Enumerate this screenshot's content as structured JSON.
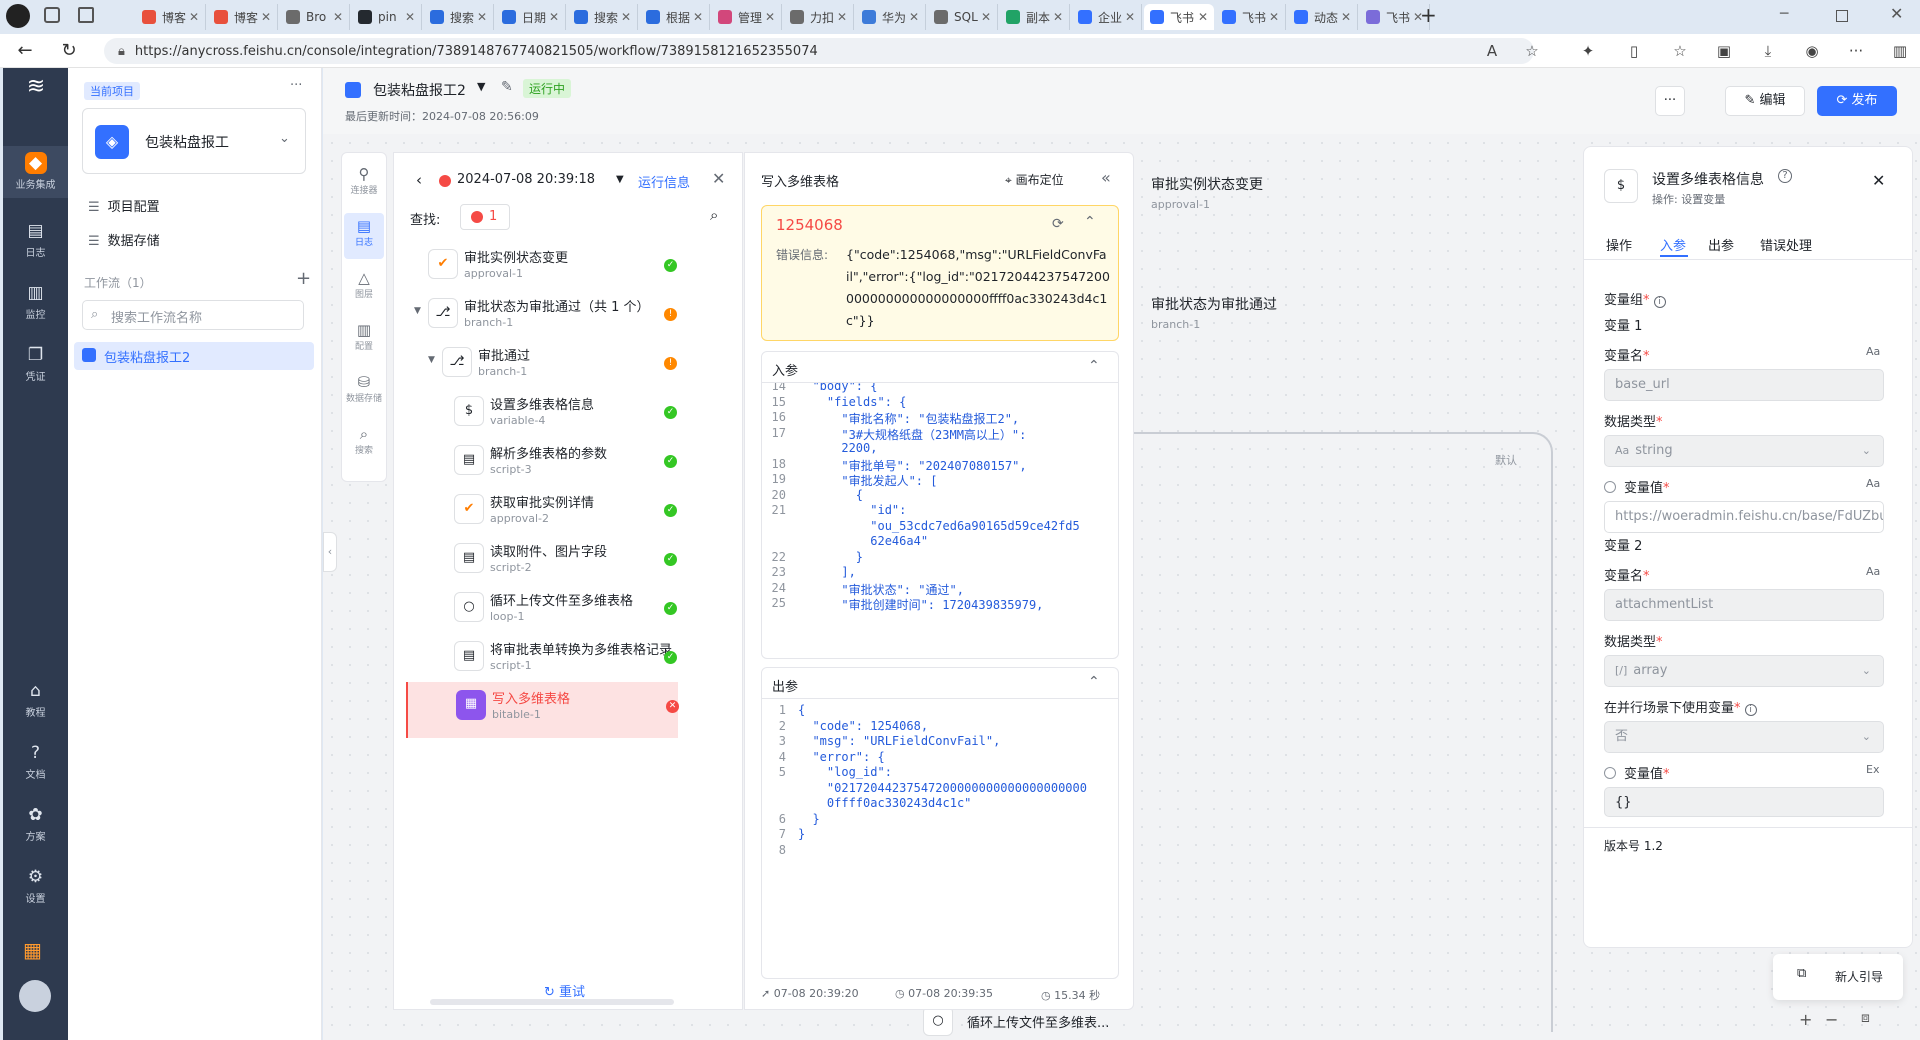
{
  "browser": {
    "tabs": [
      {
        "label": "博客",
        "color": "#e8503c"
      },
      {
        "label": "博客",
        "color": "#e8503c"
      },
      {
        "label": "Bro",
        "color": "#6b6b6b"
      },
      {
        "label": "pin",
        "color": "#24292f"
      },
      {
        "label": "搜索",
        "color": "#2b6cde"
      },
      {
        "label": "日期",
        "color": "#2b6cde"
      },
      {
        "label": "搜索",
        "color": "#2b6cde"
      },
      {
        "label": "根据",
        "color": "#2b6cde"
      },
      {
        "label": "管理",
        "color": "#d2477b"
      },
      {
        "label": "力扣",
        "color": "#6b6b6b"
      },
      {
        "label": "华为",
        "color": "#3d7bd9"
      },
      {
        "label": "SQL",
        "color": "#6b6b6b"
      },
      {
        "label": "副本",
        "color": "#21a366"
      },
      {
        "label": "企业",
        "color": "#3370ff"
      },
      {
        "label": "飞书",
        "color": "#3370ff"
      },
      {
        "label": "飞书",
        "color": "#3370ff"
      },
      {
        "label": "动态",
        "color": "#3370ff"
      },
      {
        "label": "飞书",
        "color": "#7b6cd9"
      }
    ],
    "url": "https://anycross.feishu.cn/console/integration/7389148767740821505/workflow/7389158121652355074"
  },
  "rail": {
    "items": [
      {
        "label": "业务集成"
      },
      {
        "label": "日志"
      },
      {
        "label": "监控"
      },
      {
        "label": "凭证"
      }
    ],
    "bottom": [
      {
        "label": "教程"
      },
      {
        "label": "文档"
      },
      {
        "label": "方案"
      },
      {
        "label": "设置"
      }
    ]
  },
  "project": {
    "current_label": "当前项目",
    "name": "包装粘盘报工",
    "menu": [
      "项目配置",
      "数据存储"
    ],
    "workflows_label": "工作流（1）",
    "search_placeholder": "搜索工作流名称",
    "workflow_item": "包装粘盘报工2"
  },
  "header": {
    "title": "包装粘盘报工2",
    "status": "运行中",
    "updated": "最后更新时间：2024-07-08 20:56:09",
    "more": "···",
    "edit_label": "编辑",
    "publish_label": "发布"
  },
  "tool_strip": [
    "连接器",
    "日志",
    "图层",
    "配置",
    "数据存储",
    "搜索"
  ],
  "run": {
    "timestamp": "2024-07-08 20:39:18",
    "info_label": "运行信息",
    "find_label": "查找:",
    "error_count": "1",
    "retry_label": "重试",
    "steps": [
      {
        "title": "审批实例状态变更",
        "sub": "approval-1",
        "status": "ok"
      },
      {
        "title": "审批状态为审批通过（共 1 个）",
        "sub": "branch-1",
        "status": "warn"
      },
      {
        "title": "审批通过",
        "sub": "branch-1",
        "status": "warn"
      },
      {
        "title": "设置多维表格信息",
        "sub": "variable-4",
        "status": "ok"
      },
      {
        "title": "解析多维表格的参数",
        "sub": "script-3",
        "status": "ok"
      },
      {
        "title": "获取审批实例详情",
        "sub": "approval-2",
        "status": "ok"
      },
      {
        "title": "读取附件、图片字段",
        "sub": "script-2",
        "status": "ok"
      },
      {
        "title": "循环上传文件至多维表格",
        "sub": "loop-1",
        "status": "ok"
      },
      {
        "title": "将审批表单转换为多维表格记录",
        "sub": "script-1",
        "status": "ok"
      },
      {
        "title": "写入多维表格",
        "sub": "bitable-1",
        "status": "error"
      }
    ]
  },
  "detail": {
    "title": "写入多维表格",
    "locate_label": "画布定位",
    "error_code": "1254068",
    "error_label": "错误信息:",
    "error_message": "{\"code\":1254068,\"msg\":\"URLFieldConvFail\",\"error\":{\"log_id\":\"02172044237547200000000000000000000ffff0ac330243d4c1c\"}}",
    "input_label": "入参",
    "output_label": "出参",
    "input_lines": [
      {
        "n": "14",
        "t": "  \"body\": {"
      },
      {
        "n": "15",
        "t": "    \"fields\": {"
      },
      {
        "n": "16",
        "t": "      \"审批名称\": \"包装粘盘报工2\","
      },
      {
        "n": "17",
        "t": "      \"3#大规格纸盘（23MM高以上）\":"
      },
      {
        "n": "",
        "t": "      2200,"
      },
      {
        "n": "18",
        "t": "      \"审批单号\": \"202407080157\","
      },
      {
        "n": "19",
        "t": "      \"审批发起人\": ["
      },
      {
        "n": "20",
        "t": "        {"
      },
      {
        "n": "21",
        "t": "          \"id\":"
      },
      {
        "n": "",
        "t": "          \"ou_53cdc7ed6a90165d59ce42fd5"
      },
      {
        "n": "",
        "t": "          62e46a4\""
      },
      {
        "n": "22",
        "t": "        }"
      },
      {
        "n": "23",
        "t": "      ],"
      },
      {
        "n": "24",
        "t": "      \"审批状态\": \"通过\","
      },
      {
        "n": "25",
        "t": "      \"审批创建时间\": 1720439835979,"
      }
    ],
    "output_lines": [
      {
        "n": "1",
        "t": "{"
      },
      {
        "n": "2",
        "t": "  \"code\": 1254068,"
      },
      {
        "n": "3",
        "t": "  \"msg\": \"URLFieldConvFail\","
      },
      {
        "n": "4",
        "t": "  \"error\": {"
      },
      {
        "n": "5",
        "t": "    \"log_id\":"
      },
      {
        "n": "",
        "t": "    \"02172044237547200000000000000000000"
      },
      {
        "n": "",
        "t": "    0ffff0ac330243d4c1c\""
      },
      {
        "n": "6",
        "t": "  }"
      },
      {
        "n": "7",
        "t": "}"
      },
      {
        "n": "8",
        "t": ""
      }
    ],
    "start_time": "07-08 20:39:20",
    "end_time": "07-08 20:39:35",
    "duration": "15.34 秒"
  },
  "canvas": {
    "node1_title": "审批实例状态变更",
    "node1_sub": "approval-1",
    "node2_title": "审批状态为审批通过",
    "node2_sub": "branch-1",
    "default_label": "默认",
    "bottom_node": "循环上传文件至多维表...",
    "newbie_label": "新人引导"
  },
  "config": {
    "title": "设置多维表格信息",
    "subtitle": "操作: 设置变量",
    "tabs": [
      "操作",
      "入参",
      "出参",
      "错误处理"
    ],
    "var_group_label": "变量组",
    "var1": "变量 1",
    "var_name_label": "变量名",
    "var1_name": "base_url",
    "data_type_label": "数据类型",
    "var1_type": "string",
    "var_value_label": "变量值",
    "var1_value": "https://woeradmin.feishu.cn/base/FdUZbu",
    "var2": "变量 2",
    "var2_name": "attachmentList",
    "var2_type": "array",
    "parallel_label": "在并行场景下使用变量",
    "parallel_value": "否",
    "var2_value": "{}",
    "version": "版本号 1.2",
    "aa": "Aa",
    "ex": "Ex"
  }
}
